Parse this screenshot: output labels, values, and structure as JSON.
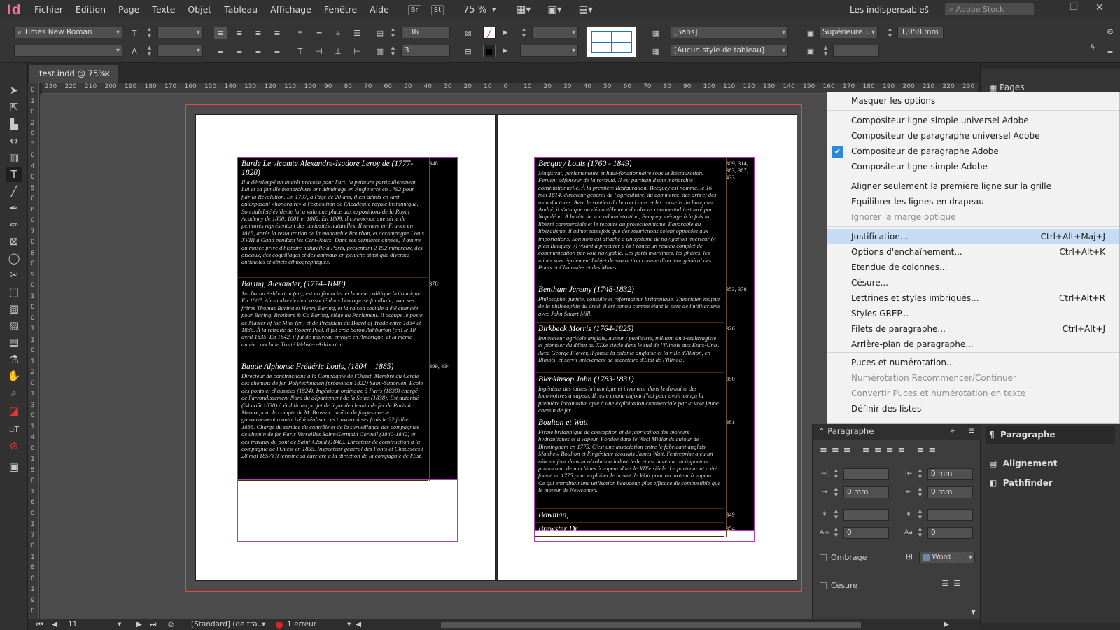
{
  "app": {
    "logo": "Id",
    "menu": [
      "Fichier",
      "Edition",
      "Page",
      "Texte",
      "Objet",
      "Tableau",
      "Affichage",
      "Fenêtre",
      "Aide"
    ],
    "bridge": "Br",
    "stock_btn": "St",
    "zoom": "75 %",
    "workspace": "Les indispensables",
    "search_placeholder": "Adobe Stock"
  },
  "control": {
    "font": "Times New Roman",
    "num1": "136",
    "num2": "3",
    "cell_style": "[Sans]",
    "table_style": "[Aucun style de tableau]",
    "valign": "Supérieure...",
    "dim": "1,058 mm"
  },
  "tab": {
    "label": "test.indd @ 75%",
    "close": "×"
  },
  "hruler": [
    "230",
    "220",
    "210",
    "200",
    "190",
    "180",
    "170",
    "160",
    "150",
    "140",
    "130",
    "120",
    "110",
    "100",
    "90",
    "80",
    "70",
    "60",
    "50",
    "40",
    "30",
    "20",
    "10",
    "0",
    "10",
    "20",
    "30",
    "40",
    "50",
    "60",
    "70",
    "80",
    "90",
    "100",
    "110",
    "120",
    "130",
    "140",
    "150",
    "160",
    "170",
    "180",
    "190",
    "200",
    "210",
    "220",
    "230"
  ],
  "vruler": [
    "0",
    "1",
    "0",
    "2",
    "0",
    "3",
    "0",
    "4",
    "0",
    "5",
    "0",
    "6",
    "0",
    "7",
    "0",
    "8",
    "0",
    "9",
    "0",
    "1",
    "0",
    "0",
    "1",
    "1",
    "0",
    "1",
    "2",
    "0",
    "1",
    "3",
    "0",
    "1",
    "4",
    "0",
    "1",
    "5",
    "0",
    "1",
    "6",
    "0",
    "1",
    "7",
    "0",
    "1",
    "8",
    "0",
    "1",
    "9",
    "0",
    "2"
  ],
  "left_table": [
    {
      "title": "Barde Le vicomte Alexandre-Isadore Leroy de (1777-1828)",
      "pages": "348",
      "body": "Il a développé un intérêt précoce pour l'art, la peinture particulièrement. Lui et sa famille monarchiste ont déménagé en Angleterre en 1792 pour fuir la Révolution. En 1797, à l'âge de 20 ans, il est admis en tant qu'exposant «honoraire» à l'exposition de l'Académie royale britannique. Son habileté évidente lui a valu une place aux expositions de la Royal Academy de 1800, 1801 et 1802. En 1809, il commence une série de peintures représentant des curiosités naturelles. Il revient en France en 1815, après la restauration de la monarchie Bourbon, et accompagne Louis XVIII à Gand pendant les Cent-Jours. Dans ses dernières années, il œuvre au musée privé d'histoire naturelle à Paris, présentant 2 192 minéraux, des oiseaux, des coquillages et des animaux en peluche ainsi que diverses antiquités et objets ethnographiques."
    },
    {
      "title": "Baring, Alexander, (1774–1848)",
      "pages": "378",
      "body": "1er baron Ashburton (en), est un financier et homme politique britannique. En 1807, Alexandre devient associé dans l'entreprise familiale, avec ses frères Thomas Baring et Henry Baring, et la raison sociale a été changée pour Baring, Brothers & Co Baring, siège au Parlement. Il occupe le poste de Master of the Mint (en) et de Président du Board of Trade entre 1834 et 1835. À la retraite de Robert Peel, il fut créé baron Ashburton (en) le 10 avril 1835. En 1842, il fut de nouveau envoyé en Amérique, et la même année conclu le Traité Webster-Ashburton."
    },
    {
      "title": "Baude Alphonse Frédéric Louis, (1804 – 1885)",
      "pages": "399, 434",
      "body": "Directeur de constructions à la Compagnie de l'Ouest, Membre du Cercle des chemins de fer. Polytechnicien (promotion 1822) Saint-Simonien. Ecole des ponts et chaussées (1824). Ingénieur ordinaire à Paris (1830) chargé de l'arrondissement Nord du département de la Seine (1838). Est autorisé (24 août 1838) à établir un projet de ligne de chemin de fer de Paris à Meaux pour le compte de M. Brossac, maître de forges que le gouvernement a autorisé à réaliser ces travaux à ses frais le 22 juillet 1838. Chargé du service du contrôle et de la surveillance des compagnies de chemin de fer Paris Versailles Saint-Germain Corbeil (1840-1842) et des travaux du pont de Saint-Cloud (1840). Directeur de construction à la compagnie de l'Ouest en 1855. Inspecteur général des Ponts et Chaussées ( 28 mai 1857) Il termine sa carrière à la direction de la compagnie de l'Est."
    }
  ],
  "right_table": [
    {
      "title": "Becquey Louis (1760 - 1849)",
      "pages": "309, 314, 383, 387, 433",
      "body": "Magistrat, parlementaire et haut-fonctionnaire sous la Restauration. Fervent défenseur de la royauté. Il est partisan d'une monarchie constitutionnelle. À la première Restauration, Becquey est nommé, le 16 mai 1814, directeur général de l'agriculture, du commerce, des arts et des manufactures. Avec le soutien du baron Louis et les conseils du banquier André, il s'attaque au démantèlement du blocus continental instauré par Napoléon. À la tête de son administration, Becquey ménage à la fois la liberté commerciale et le recours au protectionnisme. Favorable au libéralisme, il admet toutefois que des restrictions soient opposées aux importations. Son nom est attaché à un système de navigation intérieur (« plan Becquey ») visant à procurer à la France un réseau complet de communication par voie navigable. Les ports maritimes, les phares, les mines sont également l'objet de son action comme directeur général des Ponts et Chaussées et des Mines."
    },
    {
      "title": "Bentham Jeremy (1748-1832)",
      "pages": "353, 378",
      "body": "Philosophe, juriste, consulte et réformateur britannique. Théoricien majeur de la philosophie du droit, il est connu comme étant le père de l'utilitarisme avec John Stuart Mill."
    },
    {
      "title": "Birkbeck Morris (1764-1825)",
      "pages": "326",
      "body": "Innovateur agricole anglais, auteur / publiciste, militant anti-esclavagiste et pionnier du début du XIXe siècle dans le sud de l'Illinois aux Etats-Unis. Avec George Flower, il fonda la colonie anglaise et la ville d'Albion, en Illinois, et servit brièvement de secrétaire d'Etat de l'Illinois."
    },
    {
      "title": "Blenkinsop John (1783-1831)",
      "pages": "350",
      "body": "Ingénieur des mines britannique et inventeur dans le domaine des locomotives à vapeur. Il reste connu aujourd'hui pour avoir conçu la première locomotive apte à une exploitation commerciale par la voie jeune chemin de fer."
    },
    {
      "title": "Boulton et Watt",
      "pages": "381",
      "body": "Firme britannique de conception et de fabrication des moteurs hydrauliques et à vapeur. Fondée dans le West Midlands autour de Birmingham en 1775. C'est une association entre le fabricant anglais Matthew Boulton et l'ingénieur écossais James Watt, l'entreprise a eu un rôle majeur dans la révolution industrielle et est devenue un important producteur de machines à vapeur dans le XIXe siècle. Le partenariat a été formé en 1775 pour exploiter le brevet de Watt pour un moteur à vapeur. Ce qui entraînait une utilisation beaucoup plus efficace du combustible que le moteur de Newcomen."
    },
    {
      "title": "Bowman,",
      "pages": "349",
      "body": ""
    },
    {
      "title": "Brewster Dr",
      "pages": "354",
      "body": ""
    }
  ],
  "flyout": [
    {
      "label": "Masquer les options",
      "shortcut": "",
      "state": "normal"
    },
    {
      "label": "Compositeur ligne simple universel Adobe",
      "shortcut": "",
      "state": "normal"
    },
    {
      "label": "Compositeur de paragraphe universel Adobe",
      "shortcut": "",
      "state": "normal"
    },
    {
      "label": "Compositeur de paragraphe Adobe",
      "shortcut": "",
      "state": "checked"
    },
    {
      "label": "Compositeur ligne simple Adobe",
      "shortcut": "",
      "state": "normal"
    },
    {
      "label": "Aligner seulement la première ligne sur la grille",
      "shortcut": "",
      "state": "normal"
    },
    {
      "label": "Equilibrer les lignes en drapeau",
      "shortcut": "",
      "state": "normal"
    },
    {
      "label": "Ignorer la marge optique",
      "shortcut": "",
      "state": "disabled"
    },
    {
      "label": "Justification...",
      "shortcut": "Ctrl+Alt+Maj+J",
      "state": "highlight"
    },
    {
      "label": "Options d'enchaînement...",
      "shortcut": "Ctrl+Alt+K",
      "state": "normal"
    },
    {
      "label": "Etendue de colonnes...",
      "shortcut": "",
      "state": "normal"
    },
    {
      "label": "Césure...",
      "shortcut": "",
      "state": "normal"
    },
    {
      "label": "Lettrines et styles imbriqués...",
      "shortcut": "Ctrl+Alt+R",
      "state": "normal"
    },
    {
      "label": "Styles GREP...",
      "shortcut": "",
      "state": "normal"
    },
    {
      "label": "Filets de paragraphe...",
      "shortcut": "Ctrl+Alt+J",
      "state": "normal"
    },
    {
      "label": "Arrière-plan de paragraphe...",
      "shortcut": "",
      "state": "normal"
    },
    {
      "label": "Puces et numérotation...",
      "shortcut": "",
      "state": "normal"
    },
    {
      "label": "Numérotation Recommencer/Continuer",
      "shortcut": "",
      "state": "disabled"
    },
    {
      "label": "Convertir Puces et numérotation en texte",
      "shortcut": "",
      "state": "disabled"
    },
    {
      "label": "Définir des listes",
      "shortcut": "",
      "state": "normal"
    }
  ],
  "para_panel": {
    "title": "Paragraphe",
    "f1": "0 mm",
    "f2": "0 mm",
    "f3": "0 mm",
    "f4": "0",
    "f5": "0",
    "shading": "Ombrage",
    "shading_val": "Word_...",
    "hyph": "Césure"
  },
  "right_panel": {
    "pages": "Pages",
    "paragraphe": "Paragraphe",
    "alignement": "Alignement",
    "pathfinder": "Pathfinder"
  },
  "status": {
    "page": "11",
    "style": "[Standard] (de tra...",
    "errors": "1 erreur"
  }
}
